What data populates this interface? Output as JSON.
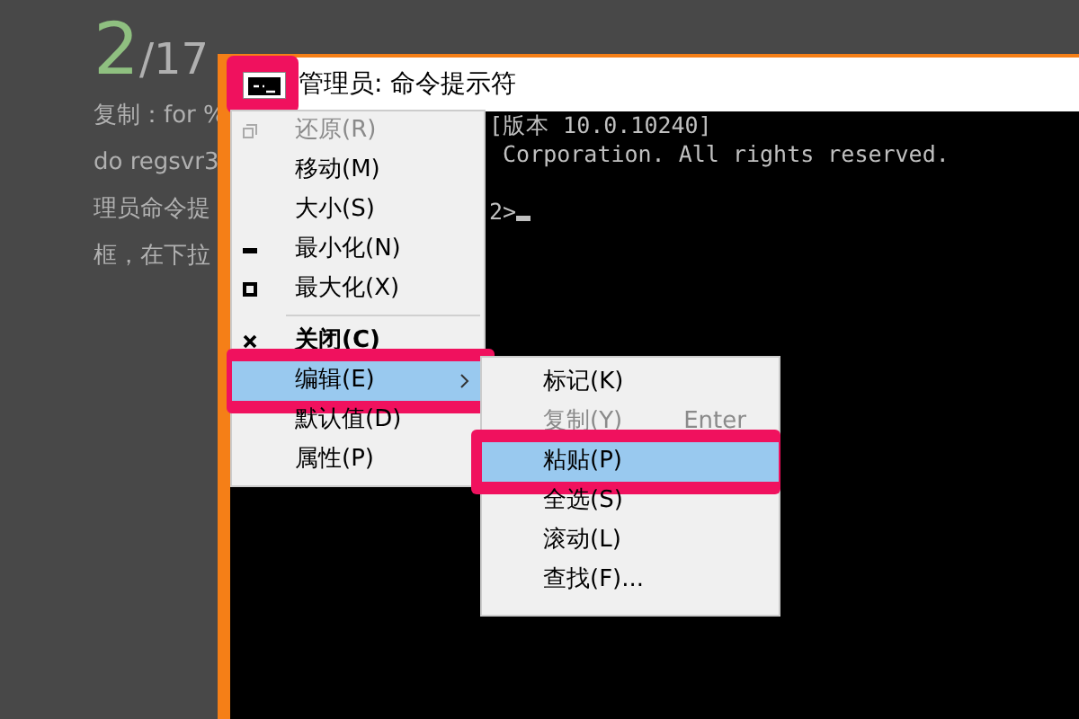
{
  "page": {
    "step": "2",
    "step_total": "/17",
    "lines": [
      "复制：for %",
      "do regsvr3",
      "理员命令提",
      "框，在下拉"
    ]
  },
  "window": {
    "title": "管理员: 命令提示符",
    "icon_highlighted": true
  },
  "console": {
    "lines": [
      "[版本 10.0.10240]",
      " Corporation. All rights reserved.",
      "2>"
    ]
  },
  "system_menu": {
    "items": [
      {
        "label": "还原(R)",
        "disabled": true,
        "selected": false,
        "bold": false
      },
      {
        "label": "移动(M)",
        "disabled": false,
        "selected": false,
        "bold": false
      },
      {
        "label": "大小(S)",
        "disabled": false,
        "selected": false,
        "bold": false
      },
      {
        "label": "最小化(N)",
        "disabled": false,
        "selected": false,
        "bold": false
      },
      {
        "label": "最大化(X)",
        "disabled": false,
        "selected": false,
        "bold": false,
        "separator_after": true
      },
      {
        "label": "关闭(C)",
        "disabled": false,
        "selected": false,
        "bold": true
      },
      {
        "label": "编辑(E)",
        "disabled": false,
        "selected": true,
        "bold": false,
        "submenu": true
      },
      {
        "label": "默认值(D)",
        "disabled": false,
        "selected": false,
        "bold": false
      },
      {
        "label": "属性(P)",
        "disabled": false,
        "selected": false,
        "bold": false
      }
    ]
  },
  "edit_submenu": {
    "items": [
      {
        "label": "标记(K)",
        "disabled": false,
        "selected": false
      },
      {
        "label": "复制(Y)",
        "shortcut": "Enter",
        "disabled": true,
        "selected": false
      },
      {
        "label": "粘贴(P)",
        "disabled": false,
        "selected": true
      },
      {
        "label": "全选(S)",
        "disabled": false,
        "selected": false
      },
      {
        "label": "滚动(L)",
        "disabled": false,
        "selected": false
      },
      {
        "label": "查找(F)...",
        "disabled": false,
        "selected": false
      }
    ]
  }
}
